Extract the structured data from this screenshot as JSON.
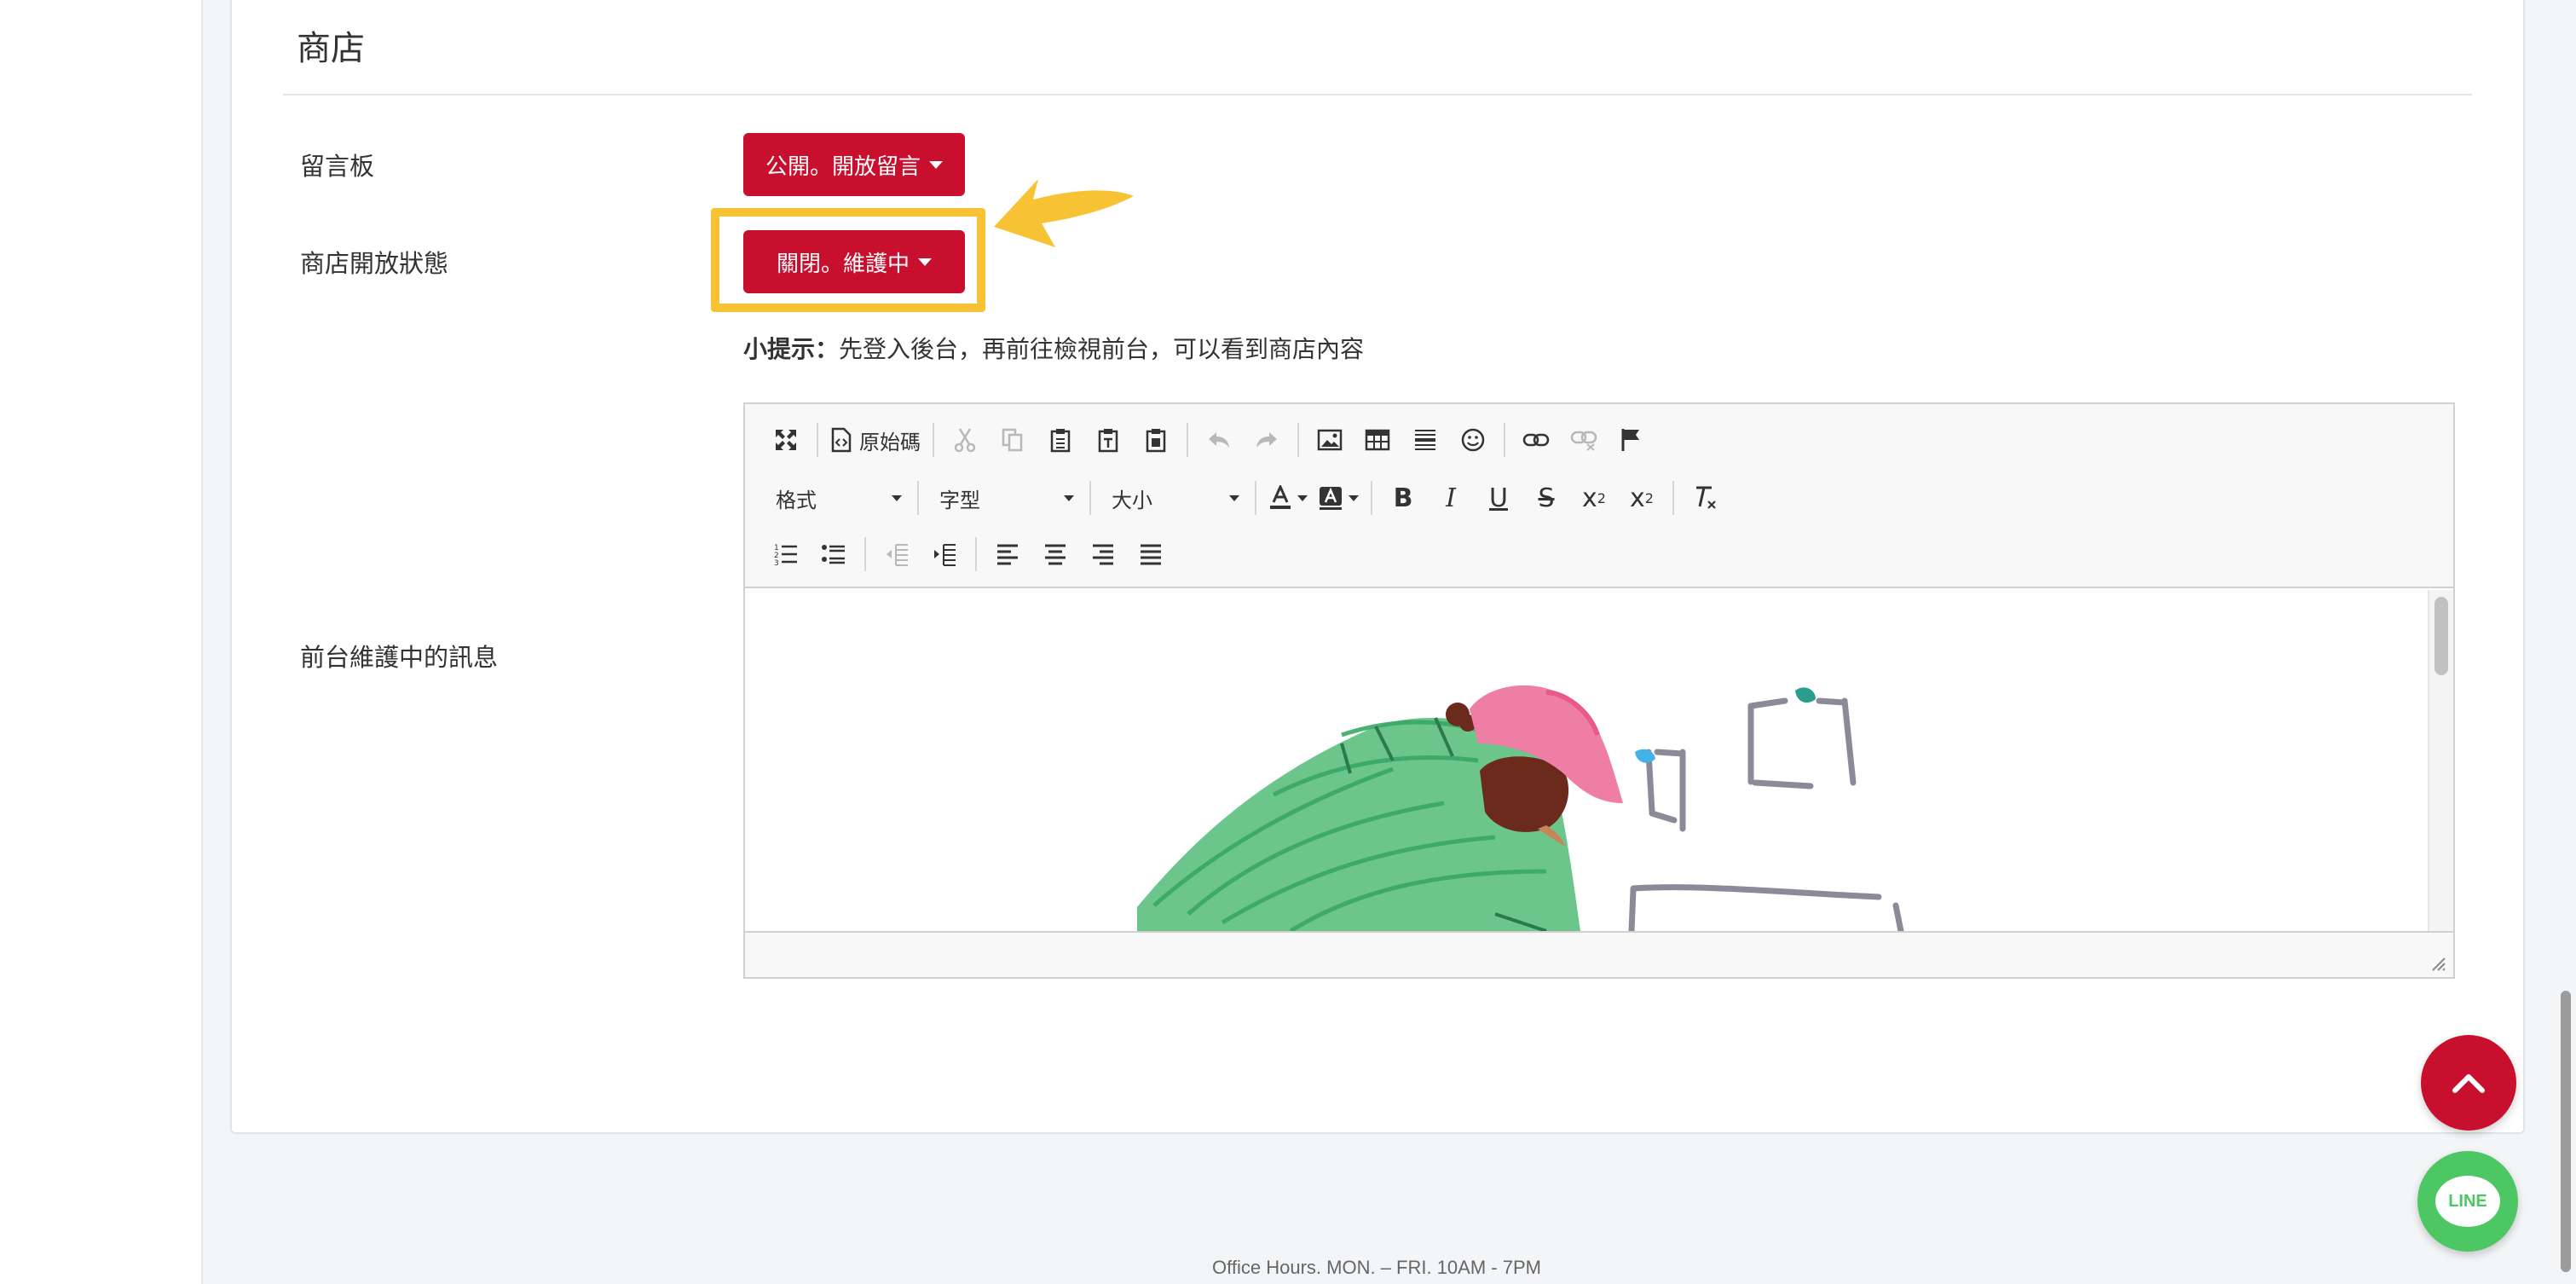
{
  "section": {
    "title": "商店"
  },
  "rows": {
    "message_board": {
      "label": "留言板",
      "button": "公開。開放留言"
    },
    "store_status": {
      "label": "商店開放狀態",
      "button": "關閉。維護中"
    },
    "maintenance_message": {
      "label": "前台維護中的訊息"
    }
  },
  "tip": {
    "prefix": "小提示：",
    "text": "先登入後台，再前往檢視前台，可以看到商店內容"
  },
  "editor": {
    "source_label": "原始碼",
    "format_label": "格式",
    "font_label": "字型",
    "size_label": "大小",
    "icons_row1": [
      "maximize-icon",
      "source-icon",
      "cut-icon",
      "copy-icon",
      "paste-icon",
      "paste-text-icon",
      "paste-word-icon",
      "undo-icon",
      "redo-icon",
      "image-icon",
      "table-icon",
      "horizontal-rule-icon",
      "smiley-icon",
      "link-icon",
      "unlink-icon",
      "anchor-flag-icon"
    ],
    "icons_row2": [
      "text-color-icon",
      "bg-color-icon",
      "bold-icon",
      "italic-icon",
      "underline-icon",
      "strike-icon",
      "subscript-icon",
      "superscript-icon",
      "remove-format-icon"
    ],
    "icons_row3": [
      "numbered-list-icon",
      "bulleted-list-icon",
      "outdent-icon",
      "indent-icon",
      "align-left-icon",
      "align-center-icon",
      "align-right-icon",
      "justify-icon"
    ]
  },
  "floating": {
    "line_label": "LINE"
  },
  "footer": {
    "text": "Office Hours.  MON. – FRI.  10AM - 7PM"
  },
  "colors": {
    "primary": "#c8102e",
    "highlight": "#f7c233",
    "line_green": "#4cc764"
  }
}
